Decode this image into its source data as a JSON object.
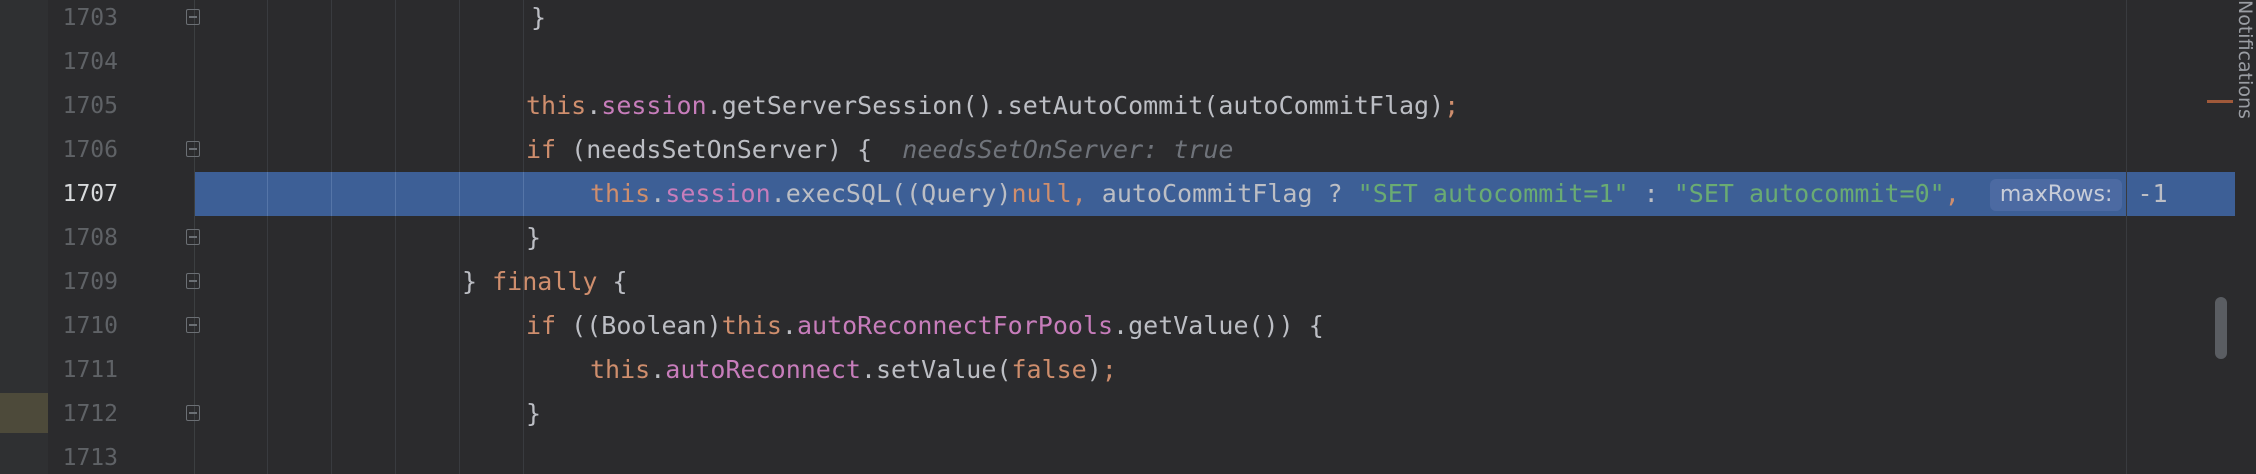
{
  "editor": {
    "current_line": "1707",
    "lines": [
      {
        "number": "1703",
        "segments": [
          {
            "t": "}",
            "c": "plain"
          }
        ]
      },
      {
        "number": "1704",
        "segments": []
      },
      {
        "number": "1705",
        "segments": [
          {
            "t": "this",
            "c": "kw"
          },
          {
            "t": ".",
            "c": "plain"
          },
          {
            "t": "session",
            "c": "fld"
          },
          {
            "t": ".getServerSession().setAutoCommit(autoCommitFlag)",
            "c": "plain"
          },
          {
            "t": ";",
            "c": "kw"
          }
        ]
      },
      {
        "number": "1706",
        "segments": [
          {
            "t": "if",
            "c": "kw"
          },
          {
            "t": " (needsSetOnServer) {  ",
            "c": "plain"
          },
          {
            "t": "needsSetOnServer: true",
            "c": "hint"
          }
        ]
      },
      {
        "number": "1707",
        "segments": [
          {
            "t": "this",
            "c": "kw"
          },
          {
            "t": ".",
            "c": "plain"
          },
          {
            "t": "session",
            "c": "fld"
          },
          {
            "t": ".execSQL((Query)",
            "c": "plain"
          },
          {
            "t": "null, ",
            "c": "kw"
          },
          {
            "t": "autoCommitFlag ? ",
            "c": "plain"
          },
          {
            "t": "\"SET autocommit=1\"",
            "c": "str"
          },
          {
            "t": " : ",
            "c": "plain"
          },
          {
            "t": "\"SET autocommit=0\"",
            "c": "str"
          },
          {
            "t": ",  ",
            "c": "kw"
          },
          {
            "t": "maxRows:",
            "c": "param"
          },
          {
            "t": " -1",
            "c": "plain"
          }
        ]
      },
      {
        "number": "1708",
        "segments": [
          {
            "t": "}",
            "c": "plain"
          }
        ]
      },
      {
        "number": "1709",
        "segments": [
          {
            "t": "} ",
            "c": "plain"
          },
          {
            "t": "finally",
            "c": "kw"
          },
          {
            "t": " {",
            "c": "plain"
          }
        ]
      },
      {
        "number": "1710",
        "segments": [
          {
            "t": "if",
            "c": "kw"
          },
          {
            "t": " ((Boolean)",
            "c": "plain"
          },
          {
            "t": "this",
            "c": "kw"
          },
          {
            "t": ".",
            "c": "plain"
          },
          {
            "t": "autoReconnectForPools",
            "c": "fld"
          },
          {
            "t": ".getValue()) {",
            "c": "plain"
          }
        ]
      },
      {
        "number": "1711",
        "segments": [
          {
            "t": "this",
            "c": "kw"
          },
          {
            "t": ".",
            "c": "plain"
          },
          {
            "t": "autoReconnect",
            "c": "fld"
          },
          {
            "t": ".setValue(",
            "c": "plain"
          },
          {
            "t": "false",
            "c": "kw"
          },
          {
            "t": ")",
            "c": "plain"
          },
          {
            "t": ";",
            "c": "kw"
          }
        ]
      },
      {
        "number": "1712",
        "segments": [
          {
            "t": "}",
            "c": "plain"
          }
        ]
      },
      {
        "number": "1713",
        "segments": []
      }
    ]
  },
  "sidebar": {
    "notifications_label": "Notifications"
  },
  "colors": {
    "background": "#2b2b2d",
    "current_line": "#3d5f96",
    "keyword": "#cf8e6d",
    "field": "#c77dbb",
    "string": "#6aab73",
    "text": "#bcbec4"
  }
}
